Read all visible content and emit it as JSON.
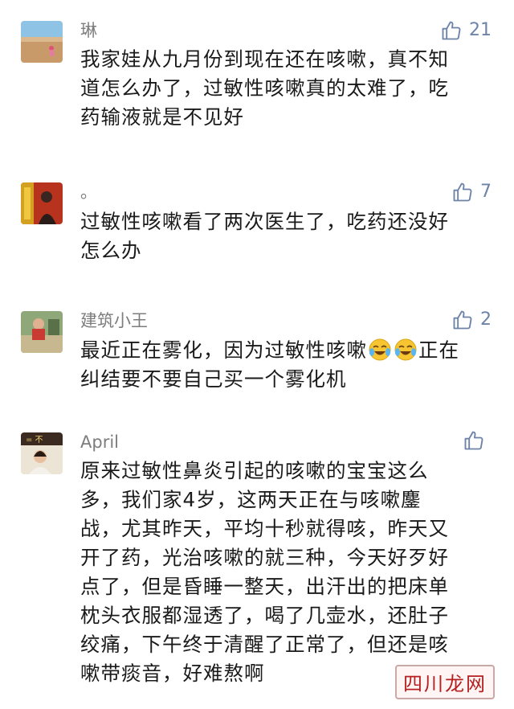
{
  "comments": [
    {
      "name": "琳",
      "likes": "21",
      "lines": [
        "我家娃从九月份到现在还在咳嗽，真不知",
        "道怎么办了，过敏性咳嗽真的太难了，吃",
        "药输液就是不见好"
      ]
    },
    {
      "name": "。",
      "likes": "7",
      "lines": [
        "过敏性咳嗽看了两次医生了，吃药还没好",
        "怎么办"
      ]
    },
    {
      "name": "建筑小王",
      "likes": "2",
      "line1_a": "最近正在雾化，因为过敏性咳嗽",
      "line1_b": "正在",
      "emoji_name": "laughing-tears-emoji",
      "line2": "纠结要不要自己买一个雾化机"
    },
    {
      "name": "April",
      "likes": "",
      "lines": [
        "原来过敏性鼻炎引起的咳嗽的宝宝这么",
        "多，我们家4岁，这两天正在与咳嗽鏖",
        "战，尤其昨天，平均十秒就得咳，昨天又",
        "开了药，光治咳嗽的就三种，今天好歹好",
        "点了，但是昏睡一整天，出汗出的把床单",
        "枕头衣服都湿透了，喝了几壶水，还肚子",
        "绞痛，下午终于清醒了正常了，但还是咳",
        "嗽带痰音，好难熬啊"
      ]
    }
  ],
  "watermark": "四川龙网",
  "colors": {
    "name": "#7d7d7d",
    "like": "#6e83a8",
    "text": "#1a1a1a"
  }
}
